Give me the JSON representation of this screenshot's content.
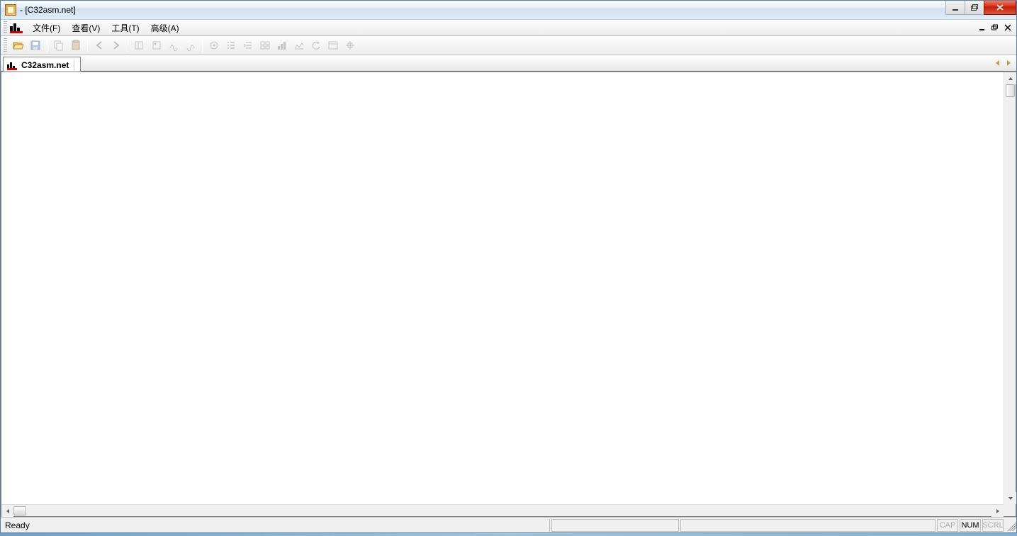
{
  "titlebar": {
    "title": " - [C32asm.net]"
  },
  "menu": {
    "file": "文件(F)",
    "view": "查看(V)",
    "tools": "工具(T)",
    "advanced": "高级(A)"
  },
  "tab": {
    "label": "C32asm.net"
  },
  "statusbar": {
    "ready": "Ready",
    "cap": "CAP",
    "num": "NUM",
    "scrl": "SCRL"
  },
  "tooltips": {
    "open": "open-icon",
    "save": "save-icon",
    "copy": "copy-icon",
    "paste": "paste-icon",
    "back": "back-icon",
    "forward": "forward-icon"
  }
}
